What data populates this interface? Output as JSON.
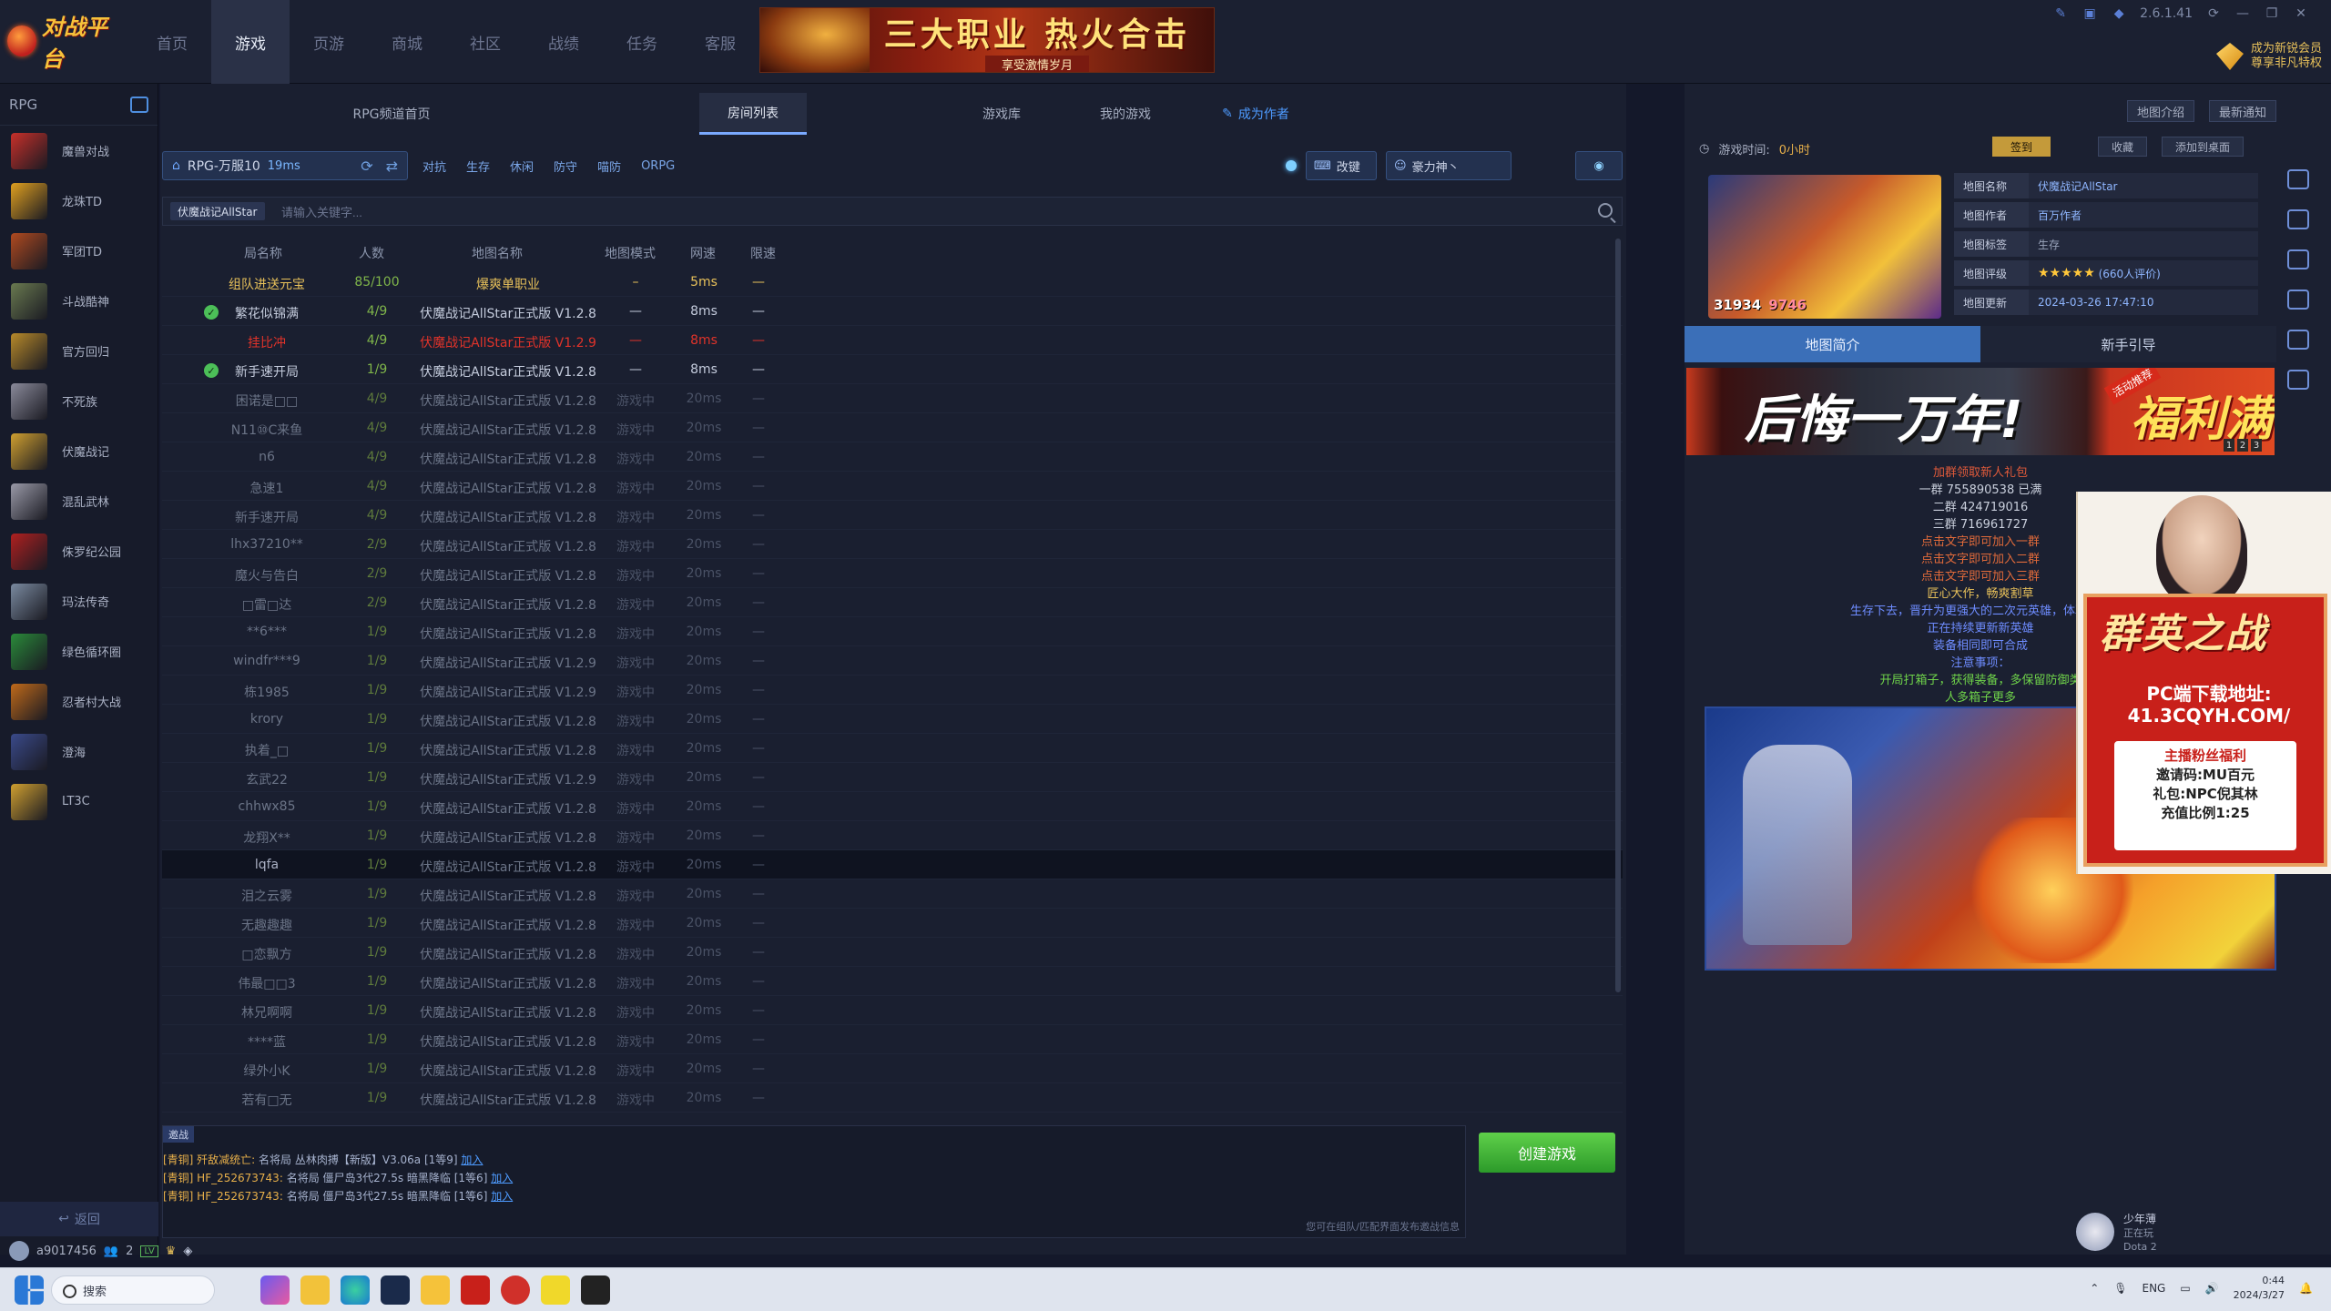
{
  "app": {
    "logo_text": "对战平台",
    "version": "2.6.1.41",
    "nav": [
      "首页",
      "游戏",
      "页游",
      "商城",
      "社区",
      "战绩",
      "任务",
      "客服"
    ],
    "banner": {
      "title": "三大职业 热火合击",
      "sub": "享受激情岁月"
    },
    "promo": {
      "line1": "成为新锐会员",
      "line2": "尊享非凡特权"
    }
  },
  "sidebar": {
    "header": "RPG",
    "games": [
      {
        "name": "魔兽对战",
        "color": "#c8302a"
      },
      {
        "name": "龙珠TD",
        "color": "#e0a020"
      },
      {
        "name": "军团TD",
        "color": "#b04a20"
      },
      {
        "name": "斗战酷神",
        "color": "#6a7a50"
      },
      {
        "name": "官方回归",
        "color": "#b88a2a"
      },
      {
        "name": "不死族",
        "color": "#8a8a9a"
      },
      {
        "name": "伏魔战记",
        "color": "#d0a030"
      },
      {
        "name": "混乱武林",
        "color": "#9a9aa8"
      },
      {
        "name": "侏罗纪公园",
        "color": "#b02020"
      },
      {
        "name": "玛法传奇",
        "color": "#7a8aa0"
      },
      {
        "name": "绿色循环圈",
        "color": "#2a8a3a"
      },
      {
        "name": "忍者村大战",
        "color": "#c06a1a"
      },
      {
        "name": "澄海",
        "color": "#3a4a8a"
      },
      {
        "name": "LT3C",
        "color": "#d0a030"
      }
    ],
    "back_label": "返回"
  },
  "tabs": [
    "RPG频道首页",
    "房间列表",
    "游戏库",
    "我的游戏",
    "成为作者"
  ],
  "server": {
    "name": "RPG-万服10",
    "ping": "19ms",
    "filters": [
      "对抗",
      "生存",
      "休闲",
      "防守",
      "喵防",
      "ORPG"
    ],
    "change_key": "改键",
    "user": "豪力神丶"
  },
  "search": {
    "tag": "伏魔战记AllStar",
    "placeholder": "请输入关键字..."
  },
  "table": {
    "headers": [
      "局名称",
      "人数",
      "地图名称",
      "地图模式",
      "网速",
      "限速"
    ],
    "rows": [
      {
        "room": "组队进送元宝",
        "count": "85/100",
        "map": "爆爽单职业",
        "mode": "–",
        "speed": "5ms",
        "limit": "—",
        "style": "top"
      },
      {
        "room": "繁花似锦满",
        "count": "4/9",
        "map": "伏魔战记AllStar正式版 V1.2.8",
        "mode": "—",
        "speed": "8ms",
        "limit": "—",
        "ok": true
      },
      {
        "room": "挂比冲",
        "count": "4/9",
        "map": "伏魔战记AllStar正式版 V1.2.9",
        "mode": "—",
        "speed": "8ms",
        "limit": "—",
        "style": "red"
      },
      {
        "room": "新手速开局",
        "count": "1/9",
        "map": "伏魔战记AllStar正式版 V1.2.8",
        "mode": "—",
        "speed": "8ms",
        "limit": "—",
        "ok": true
      },
      {
        "room": "困诺是□□",
        "count": "4/9",
        "map": "伏魔战记AllStar正式版 V1.2.8",
        "mode": "游戏中",
        "speed": "20ms",
        "limit": "—",
        "style": "dim"
      },
      {
        "room": "N11⑩C来鱼",
        "count": "4/9",
        "map": "伏魔战记AllStar正式版 V1.2.8",
        "mode": "游戏中",
        "speed": "20ms",
        "limit": "—",
        "style": "dim"
      },
      {
        "room": "n6",
        "count": "4/9",
        "map": "伏魔战记AllStar正式版 V1.2.8",
        "mode": "游戏中",
        "speed": "20ms",
        "limit": "—",
        "style": "dim"
      },
      {
        "room": "急速1",
        "count": "4/9",
        "map": "伏魔战记AllStar正式版 V1.2.8",
        "mode": "游戏中",
        "speed": "20ms",
        "limit": "—",
        "style": "dim"
      },
      {
        "room": "新手速开局",
        "count": "4/9",
        "map": "伏魔战记AllStar正式版 V1.2.8",
        "mode": "游戏中",
        "speed": "20ms",
        "limit": "—",
        "style": "dim"
      },
      {
        "room": "lhx37210**",
        "count": "2/9",
        "map": "伏魔战记AllStar正式版 V1.2.8",
        "mode": "游戏中",
        "speed": "20ms",
        "limit": "—",
        "style": "dim"
      },
      {
        "room": "魔火与告白",
        "count": "2/9",
        "map": "伏魔战记AllStar正式版 V1.2.8",
        "mode": "游戏中",
        "speed": "20ms",
        "limit": "—",
        "style": "dim"
      },
      {
        "room": "□雷□达",
        "count": "2/9",
        "map": "伏魔战记AllStar正式版 V1.2.8",
        "mode": "游戏中",
        "speed": "20ms",
        "limit": "—",
        "style": "dim"
      },
      {
        "room": "**6***",
        "count": "1/9",
        "map": "伏魔战记AllStar正式版 V1.2.8",
        "mode": "游戏中",
        "speed": "20ms",
        "limit": "—",
        "style": "dim"
      },
      {
        "room": "windfr***9",
        "count": "1/9",
        "map": "伏魔战记AllStar正式版 V1.2.9",
        "mode": "游戏中",
        "speed": "20ms",
        "limit": "—",
        "style": "dim"
      },
      {
        "room": "栋1985",
        "count": "1/9",
        "map": "伏魔战记AllStar正式版 V1.2.9",
        "mode": "游戏中",
        "speed": "20ms",
        "limit": "—",
        "style": "dim"
      },
      {
        "room": "krory",
        "count": "1/9",
        "map": "伏魔战记AllStar正式版 V1.2.8",
        "mode": "游戏中",
        "speed": "20ms",
        "limit": "—",
        "style": "dim"
      },
      {
        "room": "执着_□",
        "count": "1/9",
        "map": "伏魔战记AllStar正式版 V1.2.8",
        "mode": "游戏中",
        "speed": "20ms",
        "limit": "—",
        "style": "dim"
      },
      {
        "room": "玄武22",
        "count": "1/9",
        "map": "伏魔战记AllStar正式版 V1.2.9",
        "mode": "游戏中",
        "speed": "20ms",
        "limit": "—",
        "style": "dim"
      },
      {
        "room": "chhwx85",
        "count": "1/9",
        "map": "伏魔战记AllStar正式版 V1.2.8",
        "mode": "游戏中",
        "speed": "20ms",
        "limit": "—",
        "style": "dim"
      },
      {
        "room": "龙翔X**",
        "count": "1/9",
        "map": "伏魔战记AllStar正式版 V1.2.8",
        "mode": "游戏中",
        "speed": "20ms",
        "limit": "—",
        "style": "dim"
      },
      {
        "room": "lqfa",
        "count": "1/9",
        "map": "伏魔战记AllStar正式版 V1.2.8",
        "mode": "游戏中",
        "speed": "20ms",
        "limit": "—",
        "style": "dim hl"
      },
      {
        "room": "泪之云雾",
        "count": "1/9",
        "map": "伏魔战记AllStar正式版 V1.2.8",
        "mode": "游戏中",
        "speed": "20ms",
        "limit": "—",
        "style": "dim"
      },
      {
        "room": "无趣趣趣",
        "count": "1/9",
        "map": "伏魔战记AllStar正式版 V1.2.8",
        "mode": "游戏中",
        "speed": "20ms",
        "limit": "—",
        "style": "dim"
      },
      {
        "room": "□恋飘方",
        "count": "1/9",
        "map": "伏魔战记AllStar正式版 V1.2.8",
        "mode": "游戏中",
        "speed": "20ms",
        "limit": "—",
        "style": "dim"
      },
      {
        "room": "伟最□□3",
        "count": "1/9",
        "map": "伏魔战记AllStar正式版 V1.2.8",
        "mode": "游戏中",
        "speed": "20ms",
        "limit": "—",
        "style": "dim"
      },
      {
        "room": "林兄啊啊",
        "count": "1/9",
        "map": "伏魔战记AllStar正式版 V1.2.8",
        "mode": "游戏中",
        "speed": "20ms",
        "limit": "—",
        "style": "dim"
      },
      {
        "room": "****蓝",
        "count": "1/9",
        "map": "伏魔战记AllStar正式版 V1.2.8",
        "mode": "游戏中",
        "speed": "20ms",
        "limit": "—",
        "style": "dim"
      },
      {
        "room": "绿外小K",
        "count": "1/9",
        "map": "伏魔战记AllStar正式版 V1.2.8",
        "mode": "游戏中",
        "speed": "20ms",
        "limit": "—",
        "style": "dim"
      },
      {
        "room": "若有□无",
        "count": "1/9",
        "map": "伏魔战记AllStar正式版 V1.2.8",
        "mode": "游戏中",
        "speed": "20ms",
        "limit": "—",
        "style": "dim"
      }
    ]
  },
  "chat": {
    "tab": "邀战",
    "lines": [
      {
        "pre": "[青铜] 歼敌减统亡: ",
        "body": "名将局 丛林肉搏【新版】V3.06a [1等9] ",
        "join": "加入"
      },
      {
        "pre": "[青铜] HF_252673743: ",
        "body": "名将局 僵尸岛3代27.5s 暗黑降临 [1等6] ",
        "join": "加入"
      },
      {
        "pre": "[青铜] HF_252673743: ",
        "body": "名将局 僵尸岛3代27.5s 暗黑降临 [1等6] ",
        "join": "加入"
      }
    ],
    "hint": "您可在组队/匹配界面发布邀战信息"
  },
  "create_label": "创建游戏",
  "user": {
    "name": "a9017456",
    "friends": "2"
  },
  "right": {
    "top_buttons": [
      "地图介绍",
      "最新通知"
    ],
    "game_time_label": "游戏时间:",
    "game_time": "0小时",
    "sign": "签到",
    "fav": "收藏",
    "desktop": "添加到桌面",
    "likes": "31934",
    "hearts": "9746",
    "info": [
      {
        "k": "地图名称",
        "v": "伏魔战记AllStar"
      },
      {
        "k": "地图作者",
        "v": "百万作者"
      },
      {
        "k": "地图标签",
        "v": "生存"
      },
      {
        "k": "地图评级",
        "v": "(660人评价)"
      },
      {
        "k": "地图更新",
        "v": "2024-03-26 17:47:10"
      }
    ],
    "subtabs": [
      "地图简介",
      "新手引导"
    ],
    "ad": {
      "text": "后悔一万年!",
      "badge": "活动推荐",
      "right": "福利满",
      "pages": [
        "1",
        "2",
        "3"
      ]
    },
    "notes": [
      {
        "t": "加群领取新人礼包",
        "c": "r"
      },
      {
        "t": "一群 755890538 已满",
        "c": "w"
      },
      {
        "t": "二群 424719016",
        "c": "w"
      },
      {
        "t": "三群 716961727",
        "c": "w"
      },
      {
        "t": "点击文字即可加入一群",
        "c": "c1"
      },
      {
        "t": "点击文字即可加入二群",
        "c": "c1"
      },
      {
        "t": "点击文字即可加入三群",
        "c": "c1"
      },
      {
        "t": "匠心大作，畅爽割草",
        "c": "y"
      },
      {
        "t": "生存下去，晋升为更强大的二次元英雄，体验不一",
        "c": "b"
      },
      {
        "t": "正在持续更新新英雄",
        "c": "b"
      },
      {
        "t": "装备相同即可合成",
        "c": "b"
      },
      {
        "t": "注意事项：",
        "c": "b"
      },
      {
        "t": "开局打箱子，获得装备，多保留防御类",
        "c": "g"
      },
      {
        "t": "人多箱子更多",
        "c": "g"
      }
    ]
  },
  "float_ad": {
    "title": "群英之战",
    "download": "PC端下载地址:",
    "url": "41.3CQYH.COM/",
    "lines": [
      "主播粉丝福利",
      "邀请码:MU百元",
      "礼包:NPC倪其林",
      "充值比例1:25"
    ]
  },
  "friend": {
    "name": "少年薄",
    "status": "正在玩",
    "game": "Dota 2"
  },
  "taskbar": {
    "search": "搜索",
    "lang": "ENG",
    "time": "0:44",
    "date": "2024/3/27"
  }
}
